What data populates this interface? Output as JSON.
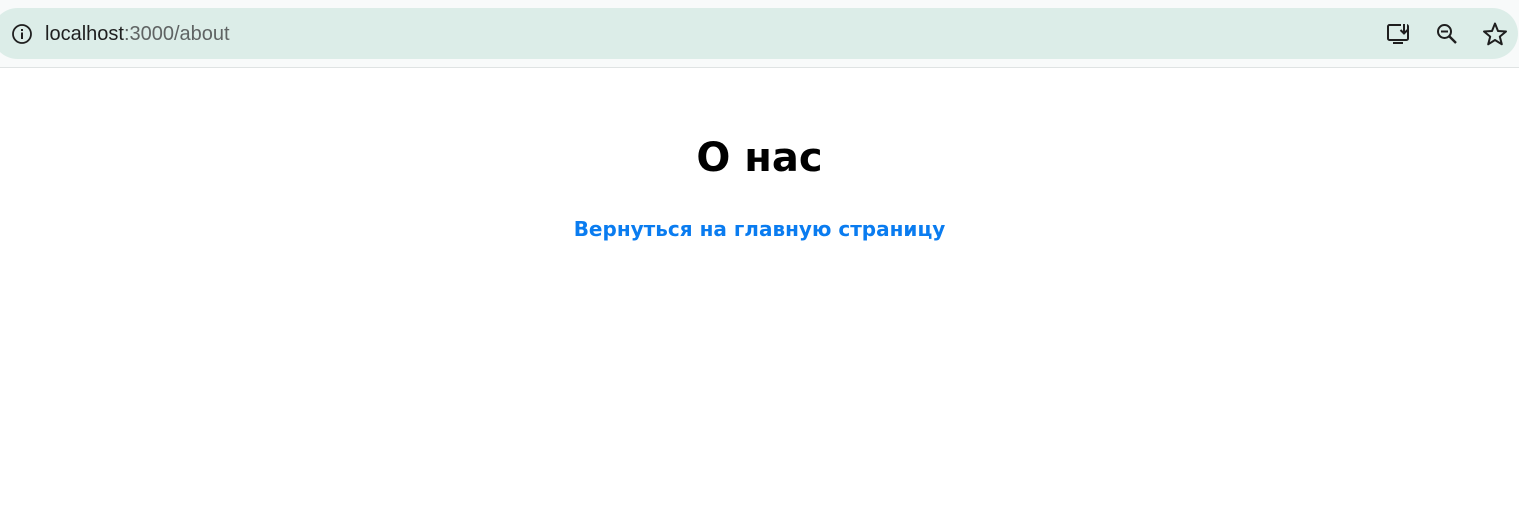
{
  "browser": {
    "url_host": "localhost",
    "url_path": ":3000/about",
    "icons": {
      "site_info": "info-icon",
      "install": "install-app-icon",
      "zoom": "zoom-out-icon",
      "bookmark": "star-icon"
    }
  },
  "page": {
    "heading": "О нас",
    "back_link_label": "Вернуться на главную страницу"
  },
  "colors": {
    "link": "#0a7cf0",
    "omnibox": "#dcede8"
  }
}
